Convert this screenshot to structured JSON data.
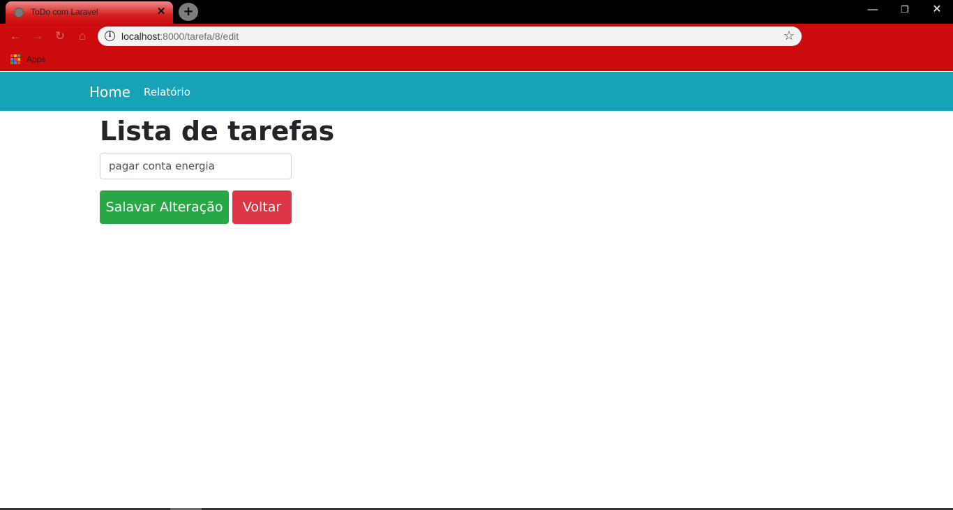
{
  "browser": {
    "tab_title": "ToDo com Laravel",
    "tab_close_glyph": "✕",
    "new_tab_glyph": "+",
    "window_controls": {
      "minimize": "—",
      "maximize": "❐",
      "close": "✕"
    },
    "nav": {
      "back": "←",
      "forward": "→",
      "reload": "↻",
      "home": "⌂"
    },
    "url_host": "localhost",
    "url_path": ":8000/tarefa/8/edit",
    "bookmark_label": "Apps",
    "apps_icon_colors": [
      "#ea4335",
      "#fbbc05",
      "#34a853",
      "#4285f4",
      "#ea4335",
      "#fbbc05",
      "#34a853",
      "#4285f4",
      "#ea4335"
    ]
  },
  "navbar": {
    "brand": "Home",
    "links": [
      "Relatório"
    ]
  },
  "main": {
    "title": "Lista de tarefas",
    "task_input_value": "pagar conta energia",
    "save_button": "Salavar Alteração",
    "back_button": "Voltar"
  },
  "colors": {
    "navbar": "#17a2b8",
    "save": "#28a745",
    "back": "#dc3545",
    "chrome": "#cc0c0c"
  }
}
